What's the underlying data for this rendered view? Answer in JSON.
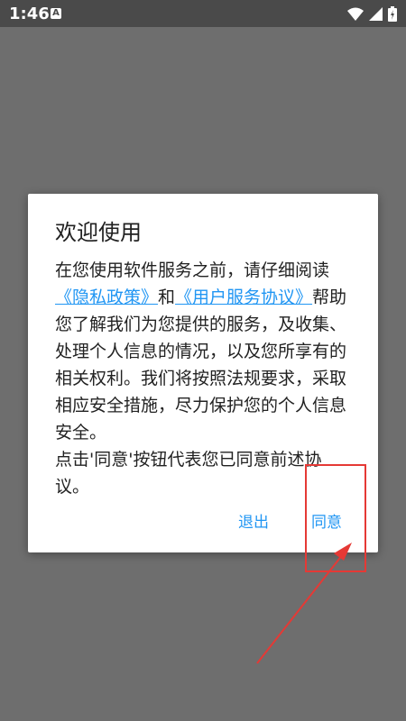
{
  "status": {
    "time": "1:46",
    "a_label": "A"
  },
  "dialog": {
    "title": "欢迎使用",
    "body_1": "在您使用软件服务之前，请仔细阅读",
    "privacy_link": "《隐私政策》",
    "and": "和",
    "terms_link": "《用户服务协议》",
    "body_2": "帮助您了解我们为您提供的服务，及收集、处理个人信息的情况，以及您所享有的相关权利。我们将按照法规要求，采取相应安全措施，尽力保护您的个人信息安全。",
    "body_3": "点击'同意'按钮代表您已同意前述协议。",
    "exit_label": "退出",
    "agree_label": "同意"
  },
  "colors": {
    "accent": "#2196f3",
    "highlight": "#e53935",
    "overlay": "#6e6e6e"
  },
  "icons": [
    "wifi-icon",
    "signal-icon",
    "battery-icon",
    "arrow-annotation"
  ]
}
